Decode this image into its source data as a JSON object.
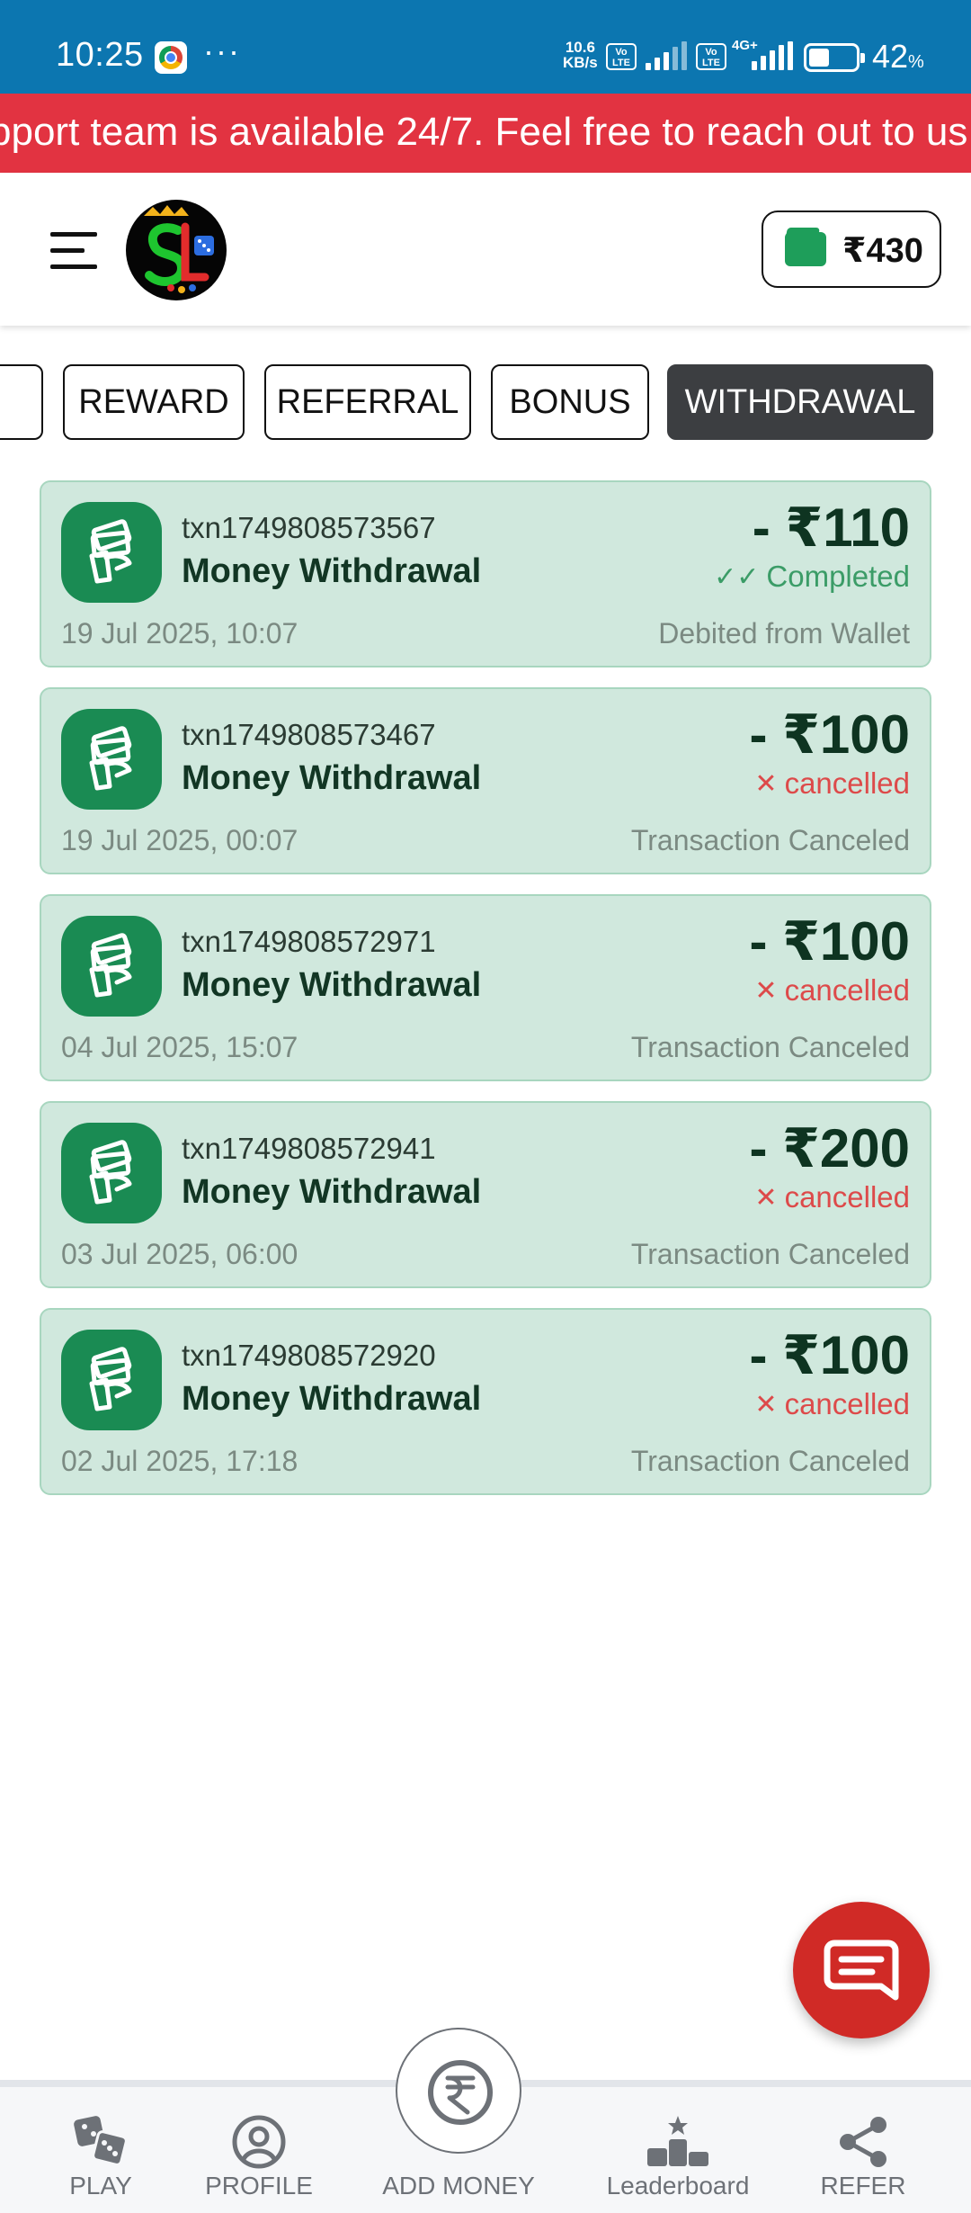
{
  "status_bar": {
    "time": "10:25",
    "more": "···",
    "net_speed_value": "10.6",
    "net_speed_unit": "KB/s",
    "volte1": "Vo LTE",
    "volte2": "Vo LTE",
    "network_type": "4G+",
    "battery_level": 0.42,
    "battery_pct": "42",
    "battery_unit": "%"
  },
  "marquee": {
    "text": "pport team is available 24/7. Feel free to reach out to us"
  },
  "header": {
    "wallet_balance": "₹430",
    "wallet_color": "#1e9e5a"
  },
  "tabs": [
    {
      "label": ""
    },
    {
      "label": "REWARD"
    },
    {
      "label": "REFERRAL"
    },
    {
      "label": "BONUS"
    },
    {
      "label": "WITHDRAWAL",
      "active": true
    }
  ],
  "transactions": [
    {
      "id": "txn1749808573567",
      "title": "Money Withdrawal",
      "amount": "- ₹110",
      "status": "Completed",
      "status_type": "completed",
      "date": "19 Jul 2025, 10:07",
      "note": "Debited from Wallet"
    },
    {
      "id": "txn1749808573467",
      "title": "Money Withdrawal",
      "amount": "- ₹100",
      "status": "cancelled",
      "status_type": "cancelled",
      "date": "19 Jul 2025, 00:07",
      "note": "Transaction Canceled"
    },
    {
      "id": "txn1749808572971",
      "title": "Money Withdrawal",
      "amount": "- ₹100",
      "status": "cancelled",
      "status_type": "cancelled",
      "date": "04 Jul 2025, 15:07",
      "note": "Transaction Canceled"
    },
    {
      "id": "txn1749808572941",
      "title": "Money Withdrawal",
      "amount": "- ₹200",
      "status": "cancelled",
      "status_type": "cancelled",
      "date": "03 Jul 2025, 06:00",
      "note": "Transaction Canceled"
    },
    {
      "id": "txn1749808572920",
      "title": "Money Withdrawal",
      "amount": "- ₹100",
      "status": "cancelled",
      "status_type": "cancelled",
      "date": "02 Jul 2025, 17:18",
      "note": "Transaction Canceled"
    }
  ],
  "colors": {
    "status_bar": "#0c76b0",
    "marquee": "#e23341",
    "card_bg": "#d0e8dd",
    "card_icon": "#1a8b53",
    "completed": "#3b9c67",
    "cancelled": "#dd4a4a",
    "fab": "#d02a26",
    "active_tab": "#3c3e41"
  },
  "bottom_nav": {
    "play": "PLAY",
    "profile": "PROFILE",
    "add_money": "ADD MONEY",
    "leaderboard": "Leaderboard",
    "refer": "REFER"
  },
  "icons": {
    "menu": "hamburger-icon",
    "wallet": "wallet-icon",
    "txn": "money-hand-icon",
    "chat": "chat-icon",
    "play": "dice-icon",
    "profile": "user-icon",
    "add_money": "rupee-icon",
    "leaderboard": "podium-icon",
    "refer": "share-icon"
  }
}
